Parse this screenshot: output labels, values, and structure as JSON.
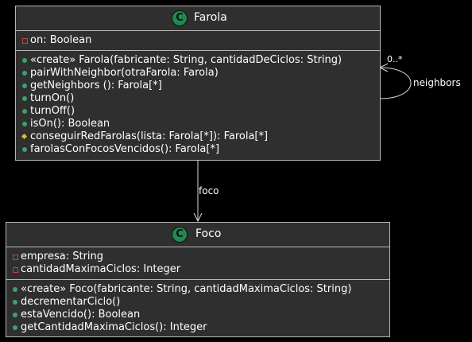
{
  "classes": {
    "farola": {
      "stereotype_badge": "C",
      "name": "Farola",
      "attributes": [
        {
          "visibility": "private",
          "text": "on: Boolean"
        }
      ],
      "methods": [
        {
          "visibility": "public",
          "text": "«create» Farola(fabricante: String, cantidadDeCiclos: String)"
        },
        {
          "visibility": "public",
          "text": "pairWithNeighbor(otraFarola: Farola)"
        },
        {
          "visibility": "public",
          "text": "getNeighbors (): Farola[*]"
        },
        {
          "visibility": "public",
          "text": "turnOn()"
        },
        {
          "visibility": "public",
          "text": "turnOff()"
        },
        {
          "visibility": "public",
          "text": "isOn(): Boolean"
        },
        {
          "visibility": "protected",
          "text": "conseguirRedFarolas(lista: Farola[*]): Farola[*]"
        },
        {
          "visibility": "public",
          "text": "farolasConFocosVencidos(): Farola[*]"
        }
      ]
    },
    "foco": {
      "stereotype_badge": "C",
      "name": "Foco",
      "attributes": [
        {
          "visibility": "private",
          "text": "empresa: String"
        },
        {
          "visibility": "private",
          "text": "cantidadMaximaCiclos: Integer"
        }
      ],
      "methods": [
        {
          "visibility": "public",
          "text": "«create» Foco(fabricante: String, cantidadMaximaCiclos: String)"
        },
        {
          "visibility": "public",
          "text": "decrementarCiclo()"
        },
        {
          "visibility": "public",
          "text": "estaVencido(): Boolean"
        },
        {
          "visibility": "public",
          "text": "getCantidadMaximaCiclos(): Integer"
        }
      ]
    }
  },
  "relations": {
    "self_assoc": {
      "label": "neighbors",
      "multiplicity": "0..*"
    },
    "foco_assoc": {
      "label": "foco"
    }
  },
  "colors": {
    "background": "#000000",
    "class_fill": "#2f2f2f",
    "border": "#b8b8b8",
    "badge": "#1f8a4f",
    "private": "#c8443c",
    "public": "#3fa068",
    "protected": "#e0b83a"
  }
}
